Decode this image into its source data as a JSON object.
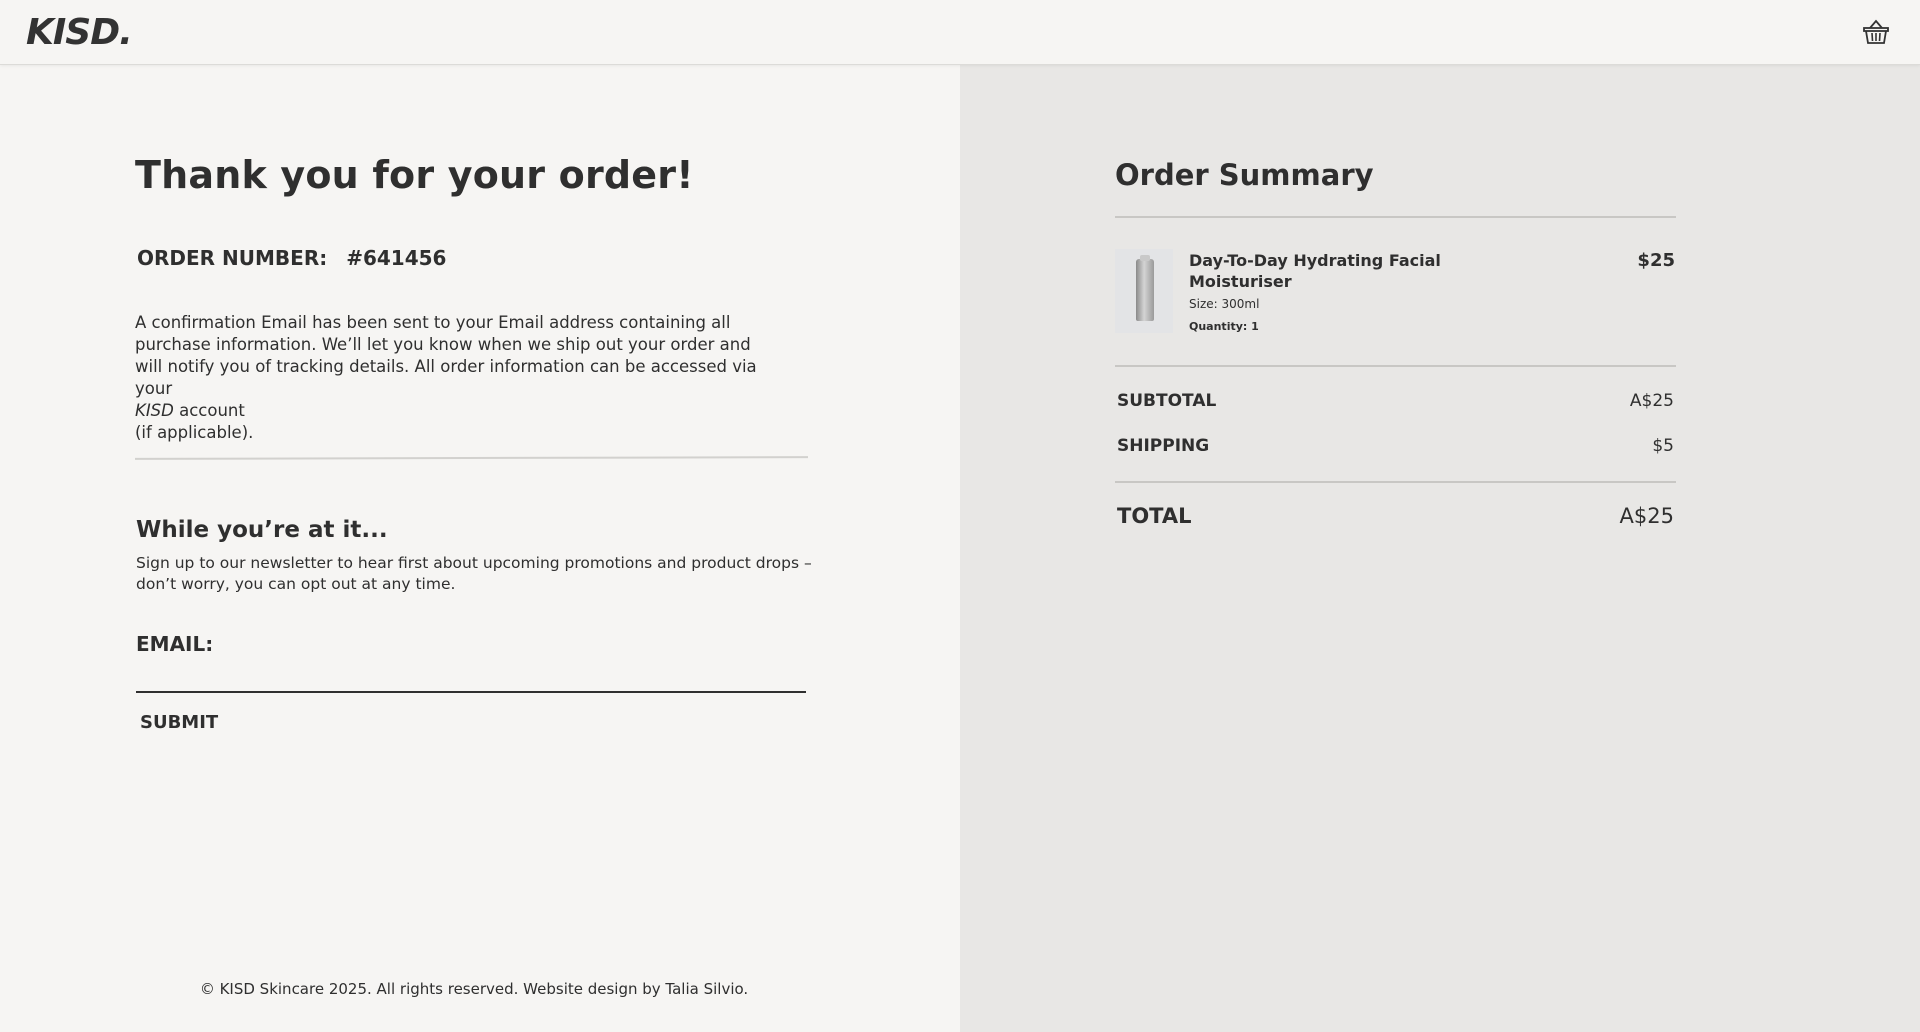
{
  "header": {
    "logo": "KISD.",
    "cart_icon": "basket-icon"
  },
  "confirmation": {
    "title": "Thank you for your order!",
    "order_number_label": "ORDER NUMBER:",
    "order_number": "#641456",
    "message_part1": "A confirmation Email has been sent to your Email address containing all purchase information. We’ll let you know when we ship out your order and will notify you of tracking details. All order information can be accessed via your",
    "message_brand": "KISD",
    "message_part2": "account",
    "message_part3": "(if applicable)."
  },
  "newsletter": {
    "title": "While you’re at it...",
    "text": "Sign up to our newsletter to hear first about upcoming promotions and product drops – don’t worry, you can opt out at any time.",
    "email_label": "EMAIL:",
    "email_value": "",
    "submit_label": "SUBMIT"
  },
  "footer": {
    "text": "© KISD Skincare 2025. All rights reserved. Website design by Talia Silvio."
  },
  "summary": {
    "title": "Order Summary",
    "items": [
      {
        "name": "Day-To-Day Hydrating Facial Moisturiser",
        "size": "Size: 300ml",
        "quantity": "Quantity: 1",
        "price": "$25"
      }
    ],
    "subtotal_label": "SUBTOTAL",
    "subtotal_value": "A$25",
    "shipping_label": "SHIPPING",
    "shipping_value": "$5",
    "total_label": "TOTAL",
    "total_value": "A$25"
  }
}
